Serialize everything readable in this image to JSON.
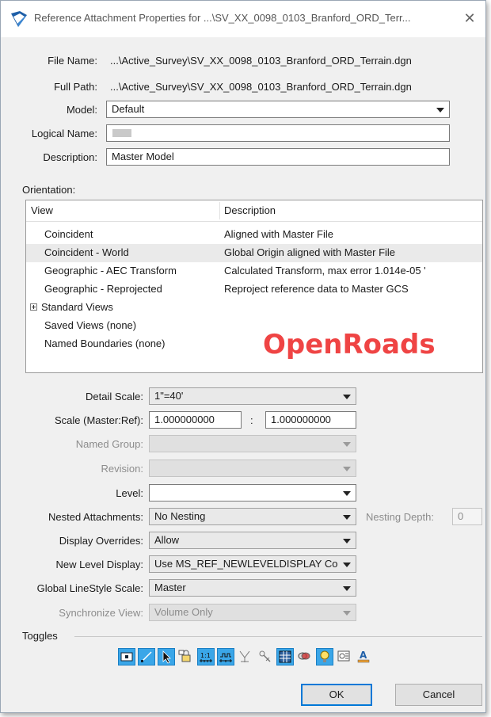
{
  "window": {
    "title": "Reference Attachment Properties for ...\\SV_XX_0098_0103_Branford_ORD_Terr...",
    "close_glyph": "✕"
  },
  "file": {
    "file_name_label": "File Name:",
    "file_name_value": "...\\Active_Survey\\SV_XX_0098_0103_Branford_ORD_Terrain.dgn",
    "full_path_label": "Full Path:",
    "full_path_value": "...\\Active_Survey\\SV_XX_0098_0103_Branford_ORD_Terrain.dgn",
    "model_label": "Model:",
    "model_value": "Default",
    "logical_name_label": "Logical Name:",
    "logical_name_value": "",
    "description_label": "Description:",
    "description_value": "Master Model"
  },
  "orientation": {
    "label": "Orientation:",
    "col_view": "View",
    "col_description": "Description",
    "rows": [
      {
        "view": "Coincident",
        "description": "Aligned with Master File"
      },
      {
        "view": "Coincident - World",
        "description": "Global Origin aligned with Master File"
      },
      {
        "view": "Geographic - AEC Transform",
        "description": "Calculated Transform, max error 1.014e-05 '"
      },
      {
        "view": "Geographic - Reprojected",
        "description": "Reproject reference data to Master GCS"
      },
      {
        "view": "Standard Views",
        "description": ""
      },
      {
        "view": "Saved Views (none)",
        "description": ""
      },
      {
        "view": "Named Boundaries (none)",
        "description": ""
      }
    ],
    "watermark": "OpenRoads"
  },
  "settings": {
    "detail_scale_label": "Detail Scale:",
    "detail_scale_value": "1\"=40'",
    "scale_label": "Scale (Master:Ref):",
    "scale_master": "1.000000000",
    "scale_sep": ":",
    "scale_ref": "1.000000000",
    "named_group_label": "Named Group:",
    "named_group_value": "",
    "revision_label": "Revision:",
    "revision_value": "",
    "level_label": "Level:",
    "level_value": "",
    "nested_label": "Nested Attachments:",
    "nested_value": "No Nesting",
    "nesting_depth_label": "Nesting Depth:",
    "nesting_depth_value": "0",
    "display_overrides_label": "Display Overrides:",
    "display_overrides_value": "Allow",
    "new_level_label": "New Level Display:",
    "new_level_value": "Use MS_REF_NEWLEVELDISPLAY Co",
    "linestyle_label": "Global LineStyle Scale:",
    "linestyle_value": "Master",
    "sync_view_label": "Synchronize View:",
    "sync_view_value": "Volume Only"
  },
  "toggles": {
    "label": "Toggles",
    "icons": [
      "display-toggle-icon",
      "snap-toggle-icon",
      "locate-toggle-icon",
      "treat-as-element-icon",
      "true-scale-icon",
      "scale-line-styles-icon",
      "ignore-attachment-icon",
      "ignore-clip-icon",
      "use-lights-icon",
      "display-raster-icon",
      "lightbulb-icon",
      "annotation-scale-icon",
      "text-style-icon"
    ]
  },
  "buttons": {
    "ok": "OK",
    "cancel": "Cancel"
  },
  "colors": {
    "accent": "#0078d7",
    "toggle_on": "#3aa6e8",
    "watermark": "#ef4444"
  }
}
